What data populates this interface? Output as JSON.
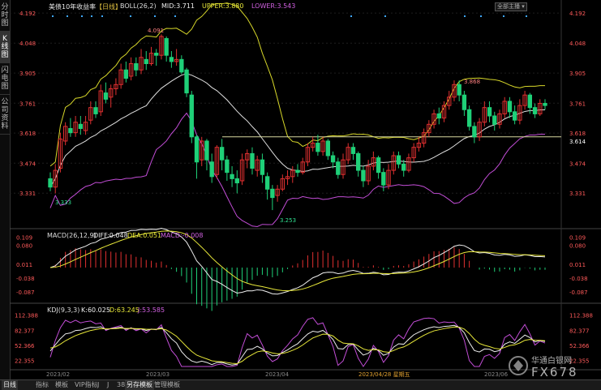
{
  "sidebar": {
    "tabs": [
      "分时图",
      "K线图",
      "闪电图",
      "公司资料"
    ]
  },
  "header": {
    "title": "美债10年收益率",
    "period": "【日线】",
    "boll_label": "BOLL(26,2)",
    "boll_mid": "MID:3.711",
    "boll_upper": "UPPER:3.880",
    "boll_lower": "LOWER:3.543",
    "toolbar_btn": "全部主播 ▾"
  },
  "macd": {
    "label": "MACD(26,12,9)",
    "diff": "DIFF:0.048",
    "dea": "DEA:0.051",
    "macd": "MACD:-0.008"
  },
  "kdj": {
    "label": "KDJ(9,3,3)",
    "k": "K:60.025",
    "d": "D:63.245",
    "j": "J:53.585"
  },
  "price_axis": [
    "4.192",
    "4.048",
    "3.905",
    "3.761",
    "3.618",
    "3.474",
    "3.331"
  ],
  "price_axis_last": "3.614",
  "macd_axis": [
    "0.109",
    "0.080",
    "0.011",
    "-0.038",
    "-0.087"
  ],
  "kdj_axis": [
    "112.388",
    "82.377",
    "52.366",
    "22.355"
  ],
  "annotations": {
    "high1": "4.091",
    "low1": "3.333",
    "low2": "3.253",
    "high2": "3.868"
  },
  "x_axis": [
    "2023/02",
    "2023/03",
    "2023/04",
    "2023/04/28 星期五",
    "2023/06"
  ],
  "bottom_tabs": [
    "日线",
    "指标",
    "模板",
    "VIP指标",
    "J",
    "J",
    "38",
    "另存模板",
    "管理模板"
  ],
  "watermark": {
    "cn": "华通白银网",
    "en": "FX678"
  },
  "colors": {
    "up": "#e03030",
    "down": "#1fd078",
    "mid": "#e0e0e0",
    "upper": "#d8d82a",
    "lower": "#c24dd6",
    "yellow": "#e8e83a"
  },
  "chart_data": {
    "type": "candlestick",
    "title": "美债10年收益率",
    "x": [
      "2023/02",
      "2023/03",
      "2023/04",
      "2023/04/28",
      "2023/06"
    ],
    "ohlc": [
      [
        3.4,
        3.36,
        3.43,
        3.34
      ],
      [
        3.36,
        3.44,
        3.47,
        3.33
      ],
      [
        3.45,
        3.59,
        3.62,
        3.43
      ],
      [
        3.58,
        3.65,
        3.67,
        3.56
      ],
      [
        3.64,
        3.62,
        3.69,
        3.6
      ],
      [
        3.62,
        3.67,
        3.7,
        3.6
      ],
      [
        3.66,
        3.64,
        3.7,
        3.61
      ],
      [
        3.63,
        3.67,
        3.7,
        3.61
      ],
      [
        3.68,
        3.74,
        3.77,
        3.66
      ],
      [
        3.74,
        3.71,
        3.77,
        3.69
      ],
      [
        3.72,
        3.82,
        3.85,
        3.7
      ],
      [
        3.81,
        3.78,
        3.86,
        3.76
      ],
      [
        3.79,
        3.83,
        3.85,
        3.74
      ],
      [
        3.83,
        3.85,
        3.88,
        3.8
      ],
      [
        3.85,
        3.92,
        3.95,
        3.83
      ],
      [
        3.92,
        3.88,
        3.96,
        3.86
      ],
      [
        3.89,
        3.95,
        3.98,
        3.87
      ],
      [
        3.95,
        3.92,
        3.98,
        3.89
      ],
      [
        3.92,
        3.98,
        4.02,
        3.9
      ],
      [
        3.97,
        3.95,
        4.01,
        3.92
      ],
      [
        3.95,
        4.0,
        4.03,
        3.94
      ],
      [
        4.0,
        3.99,
        4.02,
        3.94
      ],
      [
        3.99,
        4.08,
        4.09,
        3.97
      ],
      [
        4.07,
        3.99,
        4.08,
        3.96
      ],
      [
        3.98,
        3.96,
        4.01,
        3.93
      ],
      [
        3.96,
        3.97,
        4.02,
        3.94
      ],
      [
        3.97,
        3.91,
        3.99,
        3.9
      ],
      [
        3.92,
        3.81,
        3.93,
        3.79
      ],
      [
        3.8,
        3.6,
        3.82,
        3.57
      ],
      [
        3.6,
        3.48,
        3.61,
        3.4
      ],
      [
        3.49,
        3.58,
        3.6,
        3.46
      ],
      [
        3.58,
        3.49,
        3.59,
        3.44
      ],
      [
        3.48,
        3.41,
        3.52,
        3.38
      ],
      [
        3.42,
        3.55,
        3.56,
        3.4
      ],
      [
        3.55,
        3.49,
        3.59,
        3.44
      ],
      [
        3.49,
        3.43,
        3.51,
        3.39
      ],
      [
        3.42,
        3.4,
        3.46,
        3.36
      ],
      [
        3.4,
        3.38,
        3.44,
        3.33
      ],
      [
        3.39,
        3.49,
        3.52,
        3.37
      ],
      [
        3.49,
        3.52,
        3.54,
        3.45
      ],
      [
        3.52,
        3.45,
        3.55,
        3.42
      ],
      [
        3.44,
        3.49,
        3.51,
        3.41
      ],
      [
        3.49,
        3.42,
        3.52,
        3.38
      ],
      [
        3.41,
        3.35,
        3.43,
        3.3
      ],
      [
        3.35,
        3.31,
        3.37,
        3.25
      ],
      [
        3.32,
        3.35,
        3.37,
        3.29
      ],
      [
        3.35,
        3.4,
        3.42,
        3.34
      ],
      [
        3.4,
        3.41,
        3.44,
        3.37
      ],
      [
        3.41,
        3.44,
        3.46,
        3.38
      ],
      [
        3.44,
        3.43,
        3.47,
        3.41
      ],
      [
        3.43,
        3.48,
        3.5,
        3.42
      ],
      [
        3.48,
        3.55,
        3.57,
        3.46
      ],
      [
        3.55,
        3.57,
        3.6,
        3.53
      ],
      [
        3.57,
        3.53,
        3.61,
        3.51
      ],
      [
        3.53,
        3.58,
        3.6,
        3.51
      ],
      [
        3.58,
        3.51,
        3.59,
        3.49
      ],
      [
        3.51,
        3.48,
        3.53,
        3.45
      ],
      [
        3.48,
        3.42,
        3.5,
        3.4
      ],
      [
        3.42,
        3.49,
        3.52,
        3.4
      ],
      [
        3.49,
        3.55,
        3.57,
        3.47
      ],
      [
        3.55,
        3.52,
        3.57,
        3.49
      ],
      [
        3.52,
        3.44,
        3.53,
        3.41
      ],
      [
        3.44,
        3.39,
        3.46,
        3.36
      ],
      [
        3.39,
        3.46,
        3.49,
        3.37
      ],
      [
        3.46,
        3.5,
        3.53,
        3.44
      ],
      [
        3.5,
        3.43,
        3.51,
        3.4
      ],
      [
        3.43,
        3.37,
        3.45,
        3.34
      ],
      [
        3.37,
        3.44,
        3.47,
        3.35
      ],
      [
        3.44,
        3.51,
        3.53,
        3.42
      ],
      [
        3.51,
        3.47,
        3.53,
        3.45
      ],
      [
        3.47,
        3.44,
        3.49,
        3.41
      ],
      [
        3.44,
        3.5,
        3.52,
        3.43
      ],
      [
        3.5,
        3.55,
        3.57,
        3.48
      ],
      [
        3.55,
        3.57,
        3.6,
        3.53
      ],
      [
        3.57,
        3.62,
        3.64,
        3.55
      ],
      [
        3.62,
        3.66,
        3.68,
        3.6
      ],
      [
        3.66,
        3.71,
        3.73,
        3.64
      ],
      [
        3.71,
        3.69,
        3.74,
        3.66
      ],
      [
        3.69,
        3.75,
        3.77,
        3.67
      ],
      [
        3.75,
        3.79,
        3.82,
        3.73
      ],
      [
        3.79,
        3.85,
        3.87,
        3.77
      ],
      [
        3.85,
        3.8,
        3.87,
        3.77
      ],
      [
        3.8,
        3.73,
        3.82,
        3.7
      ],
      [
        3.73,
        3.65,
        3.75,
        3.63
      ],
      [
        3.65,
        3.6,
        3.67,
        3.57
      ],
      [
        3.6,
        3.67,
        3.69,
        3.58
      ],
      [
        3.67,
        3.74,
        3.77,
        3.65
      ],
      [
        3.74,
        3.7,
        3.77,
        3.67
      ],
      [
        3.7,
        3.66,
        3.72,
        3.63
      ],
      [
        3.66,
        3.71,
        3.73,
        3.64
      ],
      [
        3.71,
        3.77,
        3.79,
        3.69
      ],
      [
        3.77,
        3.72,
        3.79,
        3.69
      ],
      [
        3.72,
        3.68,
        3.75,
        3.66
      ],
      [
        3.68,
        3.75,
        3.78,
        3.66
      ],
      [
        3.75,
        3.8,
        3.82,
        3.73
      ],
      [
        3.8,
        3.74,
        3.81,
        3.71
      ],
      [
        3.74,
        3.71,
        3.76,
        3.69
      ],
      [
        3.71,
        3.76,
        3.78,
        3.7
      ],
      [
        3.76,
        3.75,
        3.78,
        3.73
      ]
    ]
  }
}
